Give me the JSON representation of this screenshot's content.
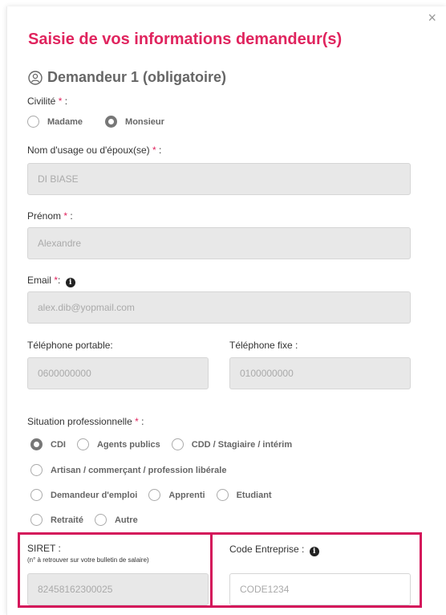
{
  "modal": {
    "close_icon": "×",
    "title": "Saisie de vos informations demandeur(s)",
    "section_title": "Demandeur 1 (obligatoire)"
  },
  "civilite": {
    "label": "Civilité",
    "required_mark": "*",
    "colon": " :",
    "options": [
      "Madame",
      "Monsieur"
    ],
    "selected": "Monsieur"
  },
  "nom": {
    "label": "Nom d'usage ou d'époux(se)",
    "required_mark": "*",
    "colon": " :",
    "value": "DI BIASE"
  },
  "prenom": {
    "label": "Prénom",
    "required_mark": "*",
    "colon": " :",
    "value": "Alexandre"
  },
  "email": {
    "label": "Email",
    "required_mark": "*",
    "colon": ":",
    "value": "alex.dib@yopmail.com",
    "info_icon": "i"
  },
  "tel_portable": {
    "label": "Téléphone portable:",
    "value": "0600000000"
  },
  "tel_fixe": {
    "label": "Téléphone fixe :",
    "value": "0100000000"
  },
  "situation": {
    "label": "Situation professionnelle",
    "required_mark": "*",
    "colon": " :",
    "rows": [
      [
        "CDI",
        "Agents publics",
        "CDD / Stagiaire / intérim"
      ],
      [
        "Artisan / commerçant / profession libérale"
      ],
      [
        "Demandeur d'emploi",
        "Apprenti",
        "Etudiant"
      ],
      [
        "Retraité",
        "Autre"
      ]
    ],
    "selected": "CDI"
  },
  "siret": {
    "label": "SIRET :",
    "note": "(n° à retrouver sur votre bulletin de salaire)",
    "value": "82458162300025"
  },
  "code_entreprise": {
    "label": "Code Entreprise :",
    "placeholder": "CODE1234",
    "info_icon": "i"
  },
  "colors": {
    "accent": "#e0245e",
    "highlight": "#d4145a"
  }
}
